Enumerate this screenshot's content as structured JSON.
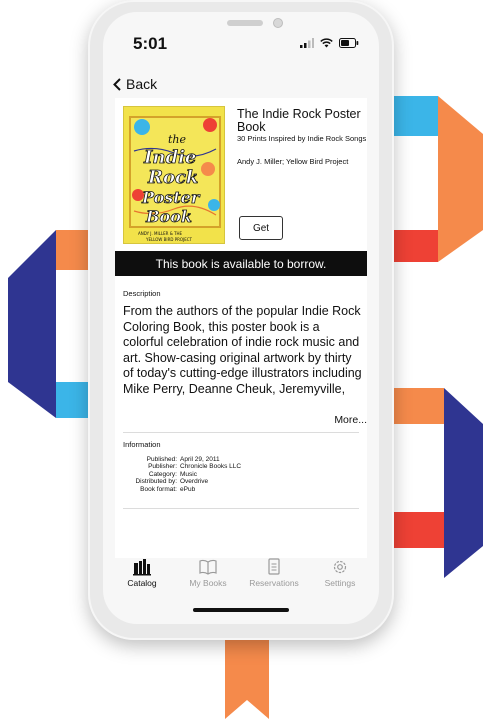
{
  "status_bar": {
    "time": "5:01"
  },
  "nav": {
    "back_label": "Back"
  },
  "book": {
    "title": "The Indie Rock Poster Book",
    "subtitle": "30 Prints Inspired by Indie Rock Songs",
    "author": "Andy J. Miller; Yellow Bird Project",
    "get_label": "Get",
    "cover_text": {
      "line1": "the",
      "line2": "Indie",
      "line3": "Rock",
      "line4": "Poster",
      "line5": "Book",
      "credit1": "ANDY J. MILLER & THE",
      "credit2": "YELLOW BIRD PROJECT"
    }
  },
  "availability": {
    "message": "This book is available to borrow."
  },
  "description": {
    "label": "Description",
    "text": "From the authors of the popular Indie Rock Coloring Book, this poster book is a colorful celebration of indie rock music and art. Show-casing original artwork by thirty of today's cutting-edge illustrators including Mike Perry, Deanne Cheuk, Jeremyville, Andy J. Miller,",
    "more_label": "More..."
  },
  "information": {
    "label": "Information",
    "rows": [
      {
        "key": "Published:",
        "value": "April 29, 2011"
      },
      {
        "key": "Publisher:",
        "value": "Chronicle Books LLC"
      },
      {
        "key": "Category:",
        "value": "Music"
      },
      {
        "key": "Distributed by:",
        "value": "Overdrive"
      },
      {
        "key": "Book format:",
        "value": "ePub"
      }
    ]
  },
  "tabs": [
    {
      "label": "Catalog",
      "icon": "catalog-icon",
      "active": true
    },
    {
      "label": "My Books",
      "icon": "book-icon",
      "active": false
    },
    {
      "label": "Reservations",
      "icon": "reservations-icon",
      "active": false
    },
    {
      "label": "Settings",
      "icon": "gear-icon",
      "active": false
    }
  ],
  "colors": {
    "ribbon_orange": "#f58a4b",
    "ribbon_blue": "#3bb5e8",
    "ribbon_navy": "#2f3591",
    "ribbon_red": "#ee4135",
    "availability_bar": "#0e0e0e",
    "cover_yellow": "#f2e24a"
  }
}
